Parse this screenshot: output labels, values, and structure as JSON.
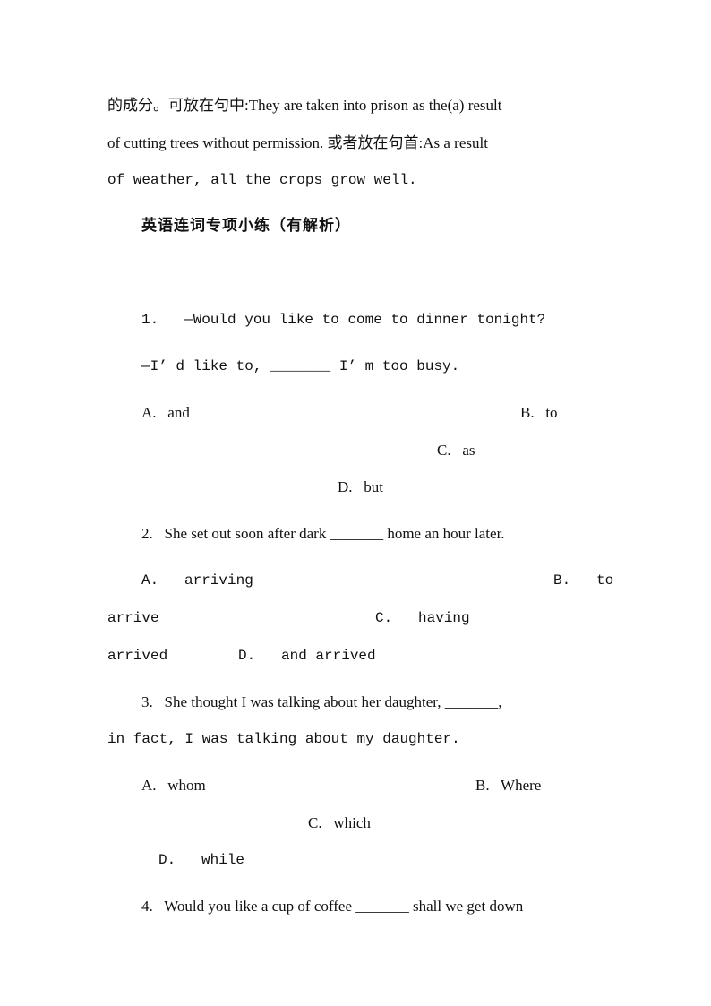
{
  "intro": {
    "line1": "的成分。可放在句中:They are taken into prison as the(a) result",
    "line2": "of cutting trees without permission. 或者放在句首:As a result",
    "line3": "of weather, all the crops grow well."
  },
  "heading": "英语连词专项小练（有解析）",
  "questions": [
    {
      "stem1": "1.   —Would you like to come to dinner tonight?",
      "stem2": "—I’ d like to, _______ I’ m too busy.",
      "A": "A.   and",
      "B": "B.   to",
      "C": "C.   as",
      "D": "D.   but"
    },
    {
      "stem1": "2.   She set out soon after dark _______ home an hour later.",
      "A": "A.   arriving",
      "B": "B.   to",
      "B_cont": "arrive",
      "C": "C.   having",
      "C_cont": "arrived",
      "D": "D.   and arrived"
    },
    {
      "stem1": "3.   She thought I was talking about her daughter, _______,",
      "stem2": "in fact, I was talking about my daughter.",
      "A": "A.   whom",
      "B": "B.   Where",
      "C": "C.   which",
      "D": "D.   while"
    },
    {
      "stem1": "4.   Would you like a cup of coffee _______ shall we get down"
    }
  ]
}
